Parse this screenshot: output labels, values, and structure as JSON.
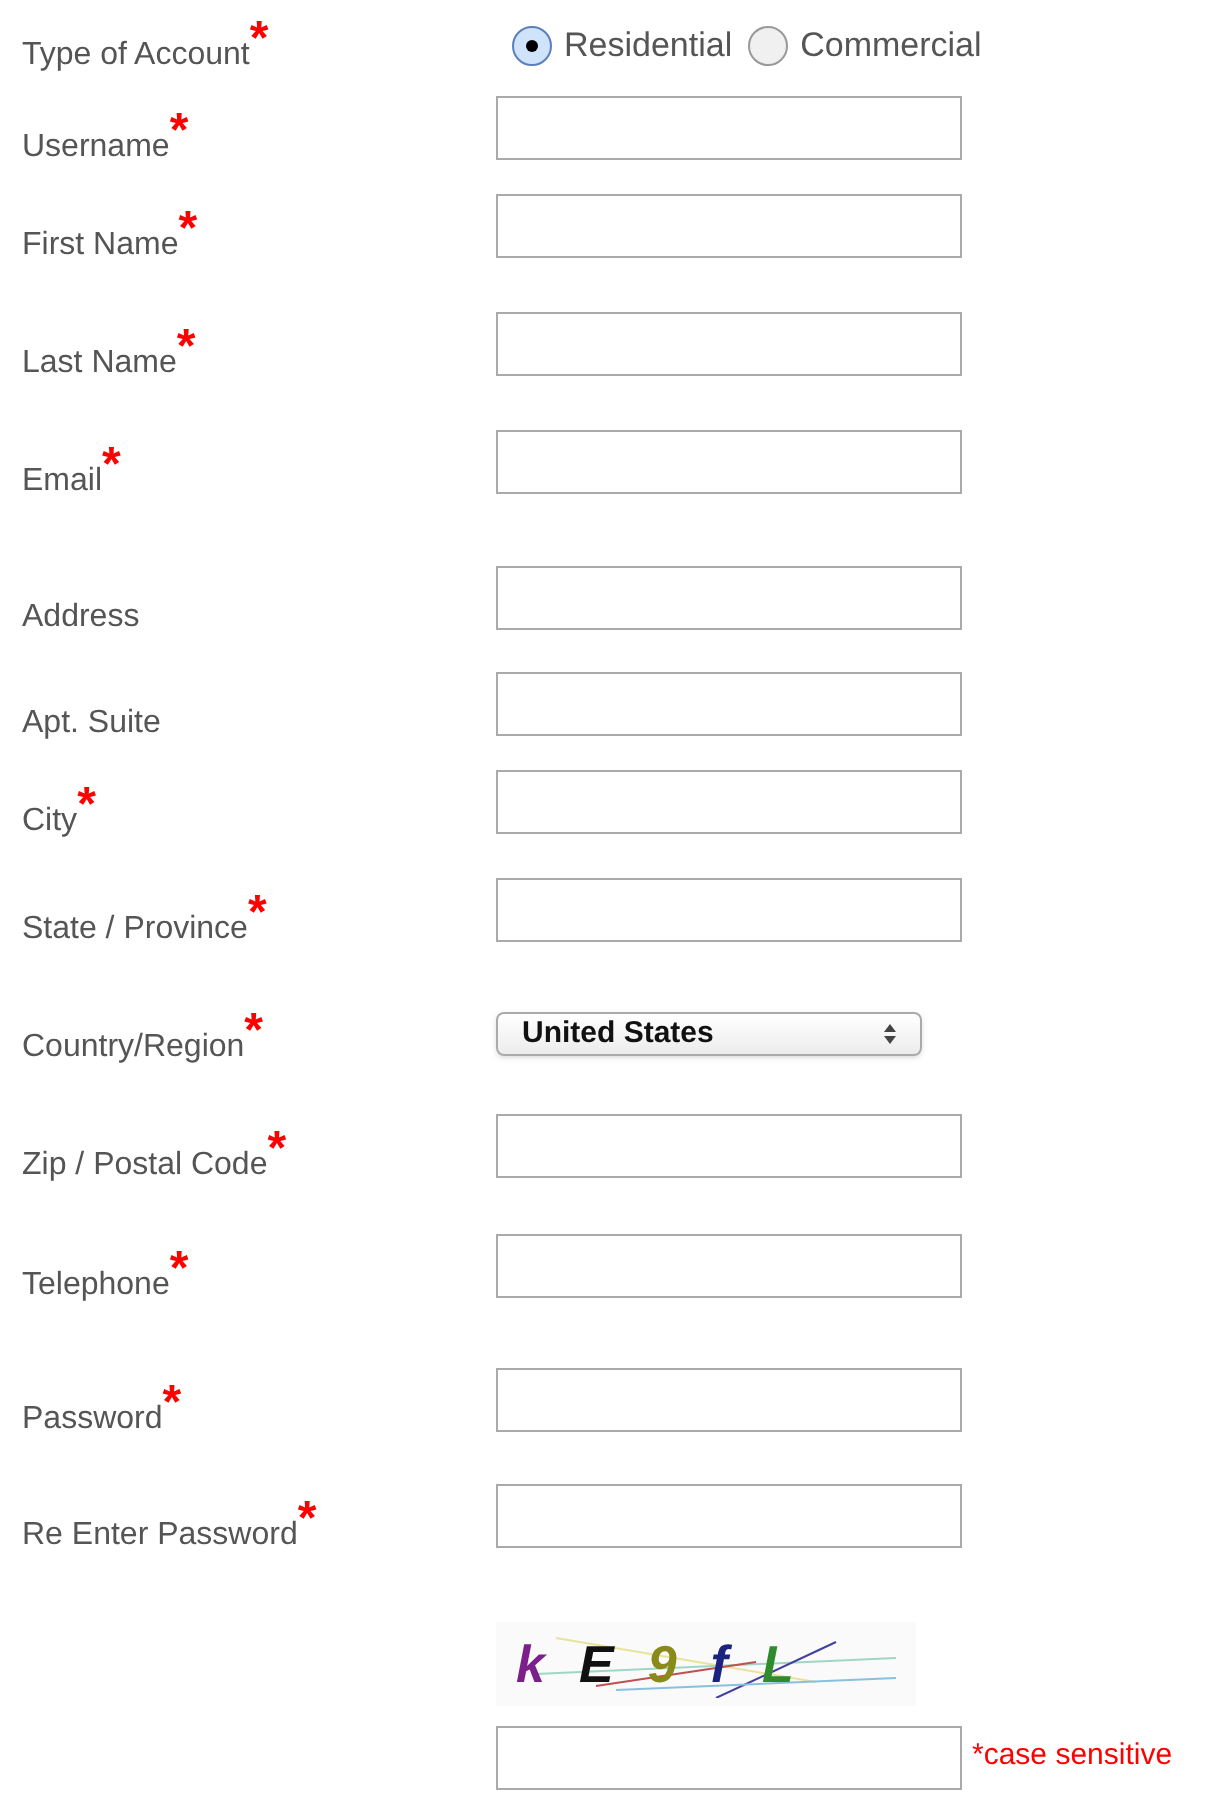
{
  "account_type": {
    "label": "Type of Account",
    "required": true,
    "options": [
      {
        "label": "Residential",
        "selected": true
      },
      {
        "label": "Commercial",
        "selected": false
      }
    ]
  },
  "fields": [
    {
      "kind": "text",
      "label": "Username",
      "required": true
    },
    {
      "kind": "text",
      "label": "First Name",
      "required": true
    },
    {
      "kind": "text",
      "label": "Last Name",
      "required": true
    },
    {
      "kind": "text",
      "label": "Email",
      "required": true
    },
    {
      "kind": "text",
      "label": "Address",
      "required": false
    },
    {
      "kind": "text",
      "label": "Apt. Suite",
      "required": false
    },
    {
      "kind": "text",
      "label": "City",
      "required": true
    },
    {
      "kind": "text",
      "label": "State / Province",
      "required": true
    },
    {
      "kind": "select",
      "label": "Country/Region",
      "required": true,
      "value": "United States"
    },
    {
      "kind": "text",
      "label": "Zip / Postal Code",
      "required": true
    },
    {
      "kind": "text",
      "label": "Telephone",
      "required": true
    },
    {
      "kind": "password",
      "label": "Password",
      "required": true
    },
    {
      "kind": "password",
      "label": "Re Enter Password",
      "required": true
    }
  ],
  "captcha": {
    "characters": [
      {
        "char": "k",
        "color": "#7b1f8a"
      },
      {
        "char": "E",
        "color": "#111111"
      },
      {
        "char": "9",
        "color": "#8a8a1a"
      },
      {
        "char": "f",
        "color": "#1a237e"
      },
      {
        "char": "L",
        "color": "#2e8b2e"
      }
    ],
    "note": "*case sensitive"
  },
  "required_mark": "*"
}
